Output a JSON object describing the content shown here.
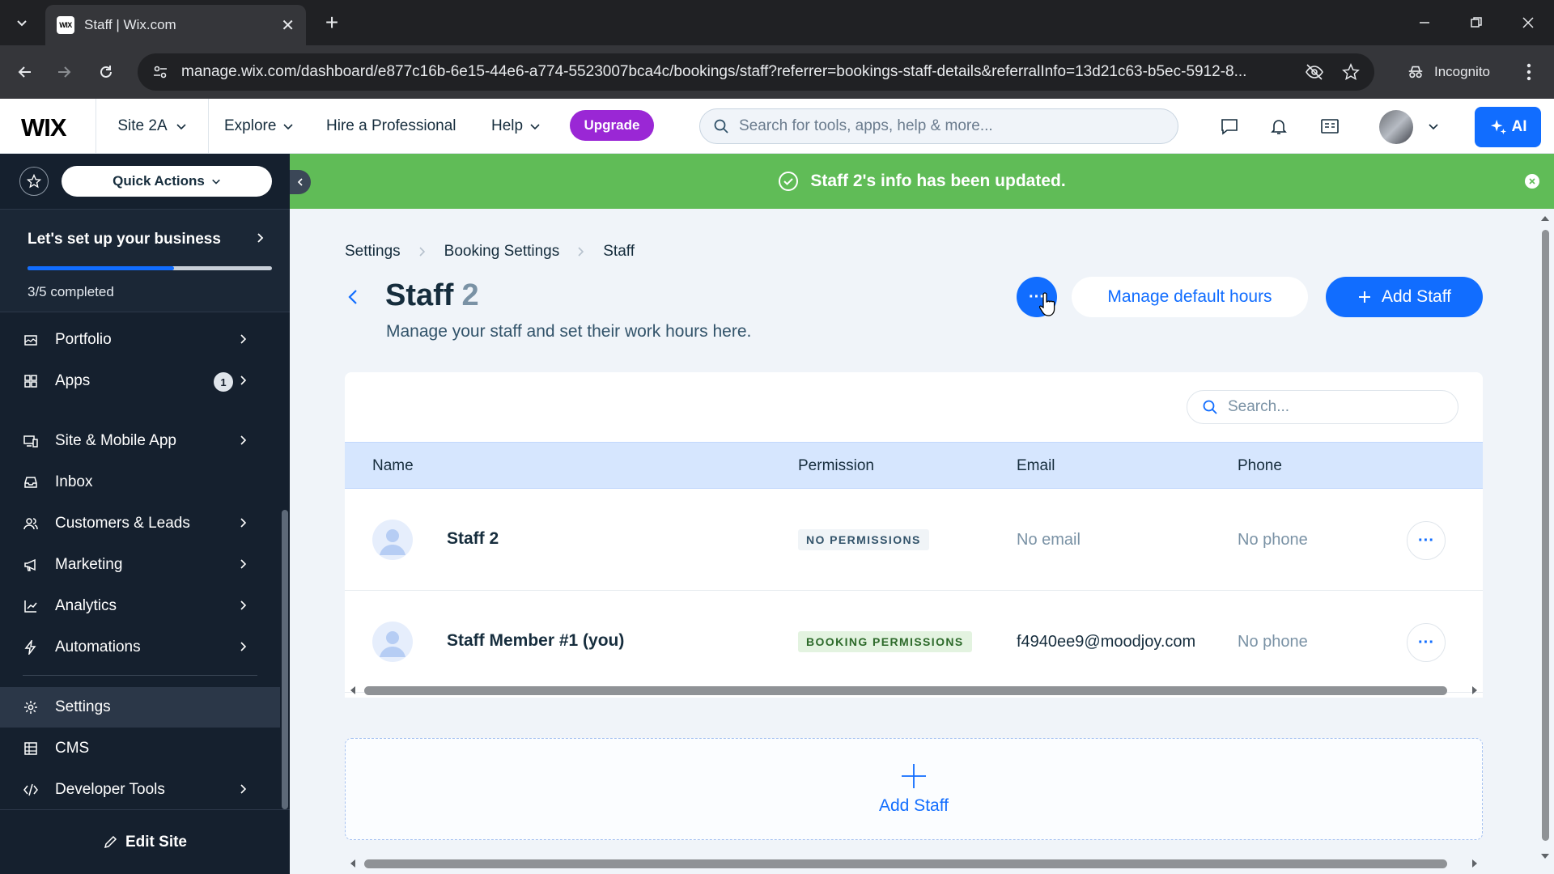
{
  "browser": {
    "tab_title": "Staff | Wix.com",
    "favicon_text": "WIX",
    "url": "manage.wix.com/dashboard/e877c16b-6e15-44e6-a774-5523007bca4c/bookings/staff?referrer=bookings-staff-details&referralInfo=13d21c63-b5ec-5912-8...",
    "incognito_label": "Incognito"
  },
  "topbar": {
    "logo": "WIX",
    "site_name": "Site 2A",
    "explore": "Explore",
    "hire": "Hire a Professional",
    "help": "Help",
    "upgrade": "Upgrade",
    "search_placeholder": "Search for tools, apps, help & more...",
    "ai_label": "AI"
  },
  "sidebar": {
    "quick_actions": "Quick Actions",
    "setup_title": "Let's set up your business",
    "setup_progress": 0.6,
    "setup_count": "3/5 completed",
    "items": [
      {
        "label": "Portfolio"
      },
      {
        "label": "Apps",
        "badge": "1"
      },
      {
        "label": "Site & Mobile App"
      },
      {
        "label": "Inbox"
      },
      {
        "label": "Customers & Leads"
      },
      {
        "label": "Marketing"
      },
      {
        "label": "Analytics"
      },
      {
        "label": "Automations"
      },
      {
        "label": "Settings"
      },
      {
        "label": "CMS"
      },
      {
        "label": "Developer Tools"
      }
    ],
    "edit_site": "Edit Site"
  },
  "toast": {
    "message": "Staff 2's info has been updated."
  },
  "breadcrumb": [
    "Settings",
    "Booking Settings",
    "Staff"
  ],
  "page": {
    "title": "Staff",
    "count": "2",
    "subtitle": "Manage your staff and set their work hours here.",
    "more_label": "···",
    "manage_hours": "Manage default hours",
    "add_staff": "Add Staff"
  },
  "table": {
    "search_placeholder": "Search...",
    "headers": {
      "name": "Name",
      "permission": "Permission",
      "email": "Email",
      "phone": "Phone"
    },
    "rows": [
      {
        "name": "Staff 2",
        "permission": "NO PERMISSIONS",
        "email": "No email",
        "phone": "No phone"
      },
      {
        "name": "Staff Member #1 (you)",
        "permission": "BOOKING PERMISSIONS",
        "email": "f4940ee9@moodjoy.com",
        "phone": "No phone"
      }
    ],
    "row_more": "···"
  },
  "add_area": {
    "label": "Add Staff"
  },
  "colors": {
    "accent": "#116dff",
    "success": "#60bc57",
    "upgrade": "#9a27d5",
    "sidebar": "#15202e"
  }
}
